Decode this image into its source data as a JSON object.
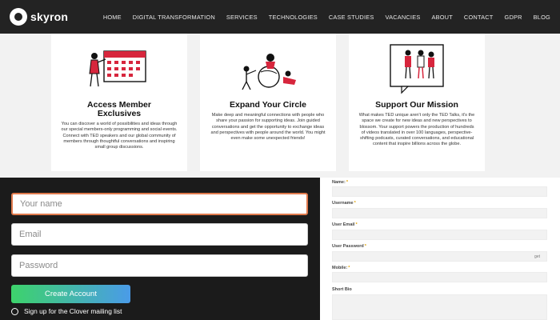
{
  "nav": {
    "logo_text": "skyron",
    "items": [
      "HOME",
      "DIGITAL TRANSFORMATION",
      "SERVICES",
      "TECHNOLOGIES",
      "CASE STUDIES",
      "VACANCIES",
      "ABOUT",
      "CONTACT",
      "GDPR",
      "BLOG"
    ]
  },
  "cards": [
    {
      "icon": "calendar-illustration",
      "title_line1": "Access Member",
      "title_line2": "Exclusives",
      "body": "You can discover a world of possibilities and ideas through our special members-only programming and social events. Connect with TED speakers and our global community of members through thoughtful conversations and inspiring small group discussions."
    },
    {
      "icon": "people-circle-illustration",
      "title_line1": "Expand Your Circle",
      "body": "Make deep and meaningful connections with people who share your passion for supporting ideas. Join guided conversations and get the opportunity to exchange ideas and perspectives with people around the world. You might even make some unexpected friends!"
    },
    {
      "icon": "speaking-people-illustration",
      "title_line1": "Support Our Mission",
      "body": "What makes TED unique aren't only the TED Talks, it's the space we create for new ideas and new perspectives to blossom. Your support powers the production of hundreds of videos translated in over 100 languages, perspective-shifting podcasts, curated conversations, and educational content that inspire billions across the globe."
    }
  ],
  "signup": {
    "name_placeholder": "Your name",
    "email_placeholder": "Email",
    "password_placeholder": "Password",
    "button_label": "Create Account",
    "mailing_label": "Sign up for the Clover mailing list"
  },
  "profile_form": {
    "fields": [
      {
        "label": "Name:",
        "required": "*"
      },
      {
        "label": "Username",
        "required": "*"
      },
      {
        "label": "User Email",
        "required": "*"
      },
      {
        "label": "User Password",
        "required": "*"
      },
      {
        "label": "Mobile:",
        "required": "*"
      },
      {
        "label": "Short Bio",
        "required": ""
      }
    ],
    "password_toggle": "get"
  },
  "colors": {
    "nav_bg": "#232323",
    "accent_red": "#d7263d",
    "focus_border": "#e07a4d",
    "button_gradient_start": "#3dd36b",
    "button_gradient_end": "#4a9be8"
  }
}
